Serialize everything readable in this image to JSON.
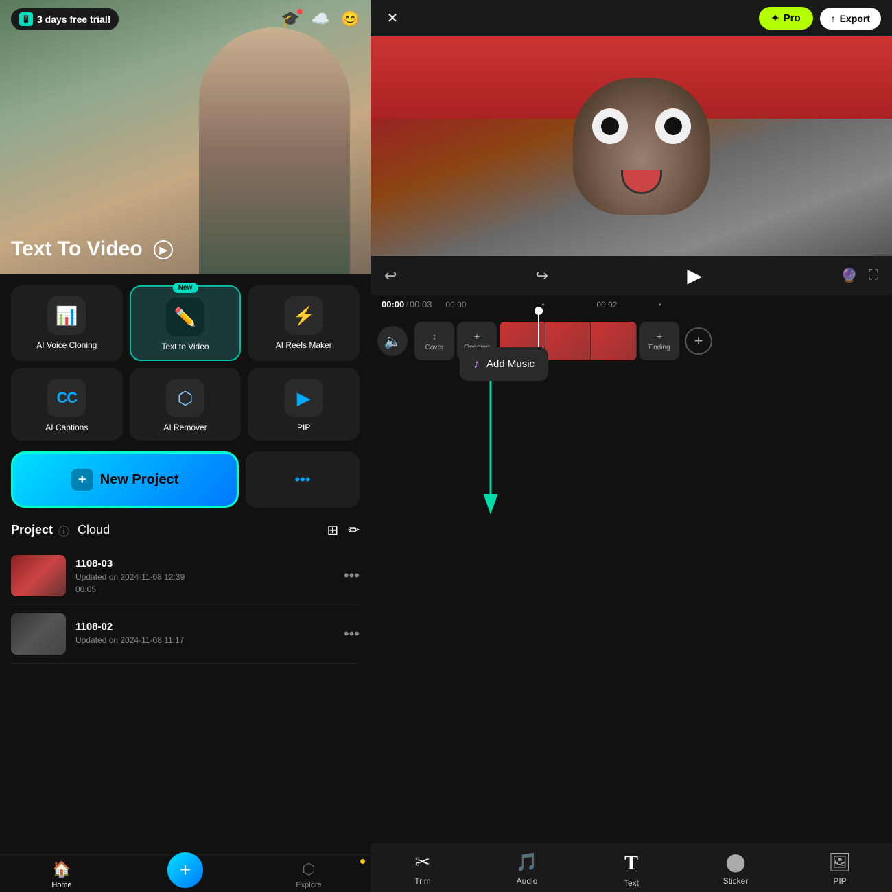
{
  "app": {
    "trial_badge": "3 days free trial!",
    "hero_title": "Text To Video",
    "hero_title_icon": "▶"
  },
  "tools": [
    {
      "id": "ai-voice",
      "label": "AI Voice Cloning",
      "icon": "📊",
      "badge": null,
      "highlighted": false
    },
    {
      "id": "text-to-video",
      "label": "Text  to Video",
      "icon": "✏️",
      "badge": "New",
      "highlighted": true
    },
    {
      "id": "ai-reels",
      "label": "AI Reels Maker",
      "icon": "⚡",
      "badge": null,
      "highlighted": false
    },
    {
      "id": "ai-captions",
      "label": "AI Captions",
      "icon": "CC",
      "badge": null,
      "highlighted": false
    },
    {
      "id": "ai-remover",
      "label": "AI Remover",
      "icon": "🔷",
      "badge": null,
      "highlighted": false
    },
    {
      "id": "pip",
      "label": "PIP",
      "icon": "▶",
      "badge": null,
      "highlighted": false
    }
  ],
  "actions": {
    "new_project_label": "New Project",
    "more_dots": "•••"
  },
  "projects_section": {
    "title": "Project",
    "cloud_label": "Cloud"
  },
  "projects": [
    {
      "id": "1108-03",
      "name": "1108-03",
      "date": "Updated on 2024-11-08 12:39",
      "duration": "00:05"
    },
    {
      "id": "1108-02",
      "name": "1108-02",
      "date": "Updated on 2024-11-08 11:17",
      "duration": ""
    }
  ],
  "bottom_nav": [
    {
      "id": "home",
      "label": "Home",
      "icon": "🏠",
      "active": true
    },
    {
      "id": "center-add",
      "label": "",
      "icon": "+",
      "active": false
    },
    {
      "id": "explore",
      "label": "Explore",
      "icon": "",
      "active": false
    }
  ],
  "right_panel": {
    "pro_label": "Pro",
    "export_label": "Export",
    "time_current": "00:00",
    "time_total": "00:03",
    "time_mark1": "00:00",
    "time_mark2": "00:02"
  },
  "timeline": {
    "cover_label": "Cover",
    "opening_label": "Opening",
    "ending_label": "Ending",
    "add_music_label": "Add Music"
  },
  "bottom_tools": [
    {
      "id": "trim",
      "label": "Trim",
      "icon": "✂"
    },
    {
      "id": "audio",
      "label": "Audio",
      "icon": "🎵"
    },
    {
      "id": "text",
      "label": "Text",
      "icon": "T"
    },
    {
      "id": "sticker",
      "label": "Sticker",
      "icon": "⬤"
    },
    {
      "id": "pip",
      "label": "PIP",
      "icon": "🖼"
    }
  ]
}
